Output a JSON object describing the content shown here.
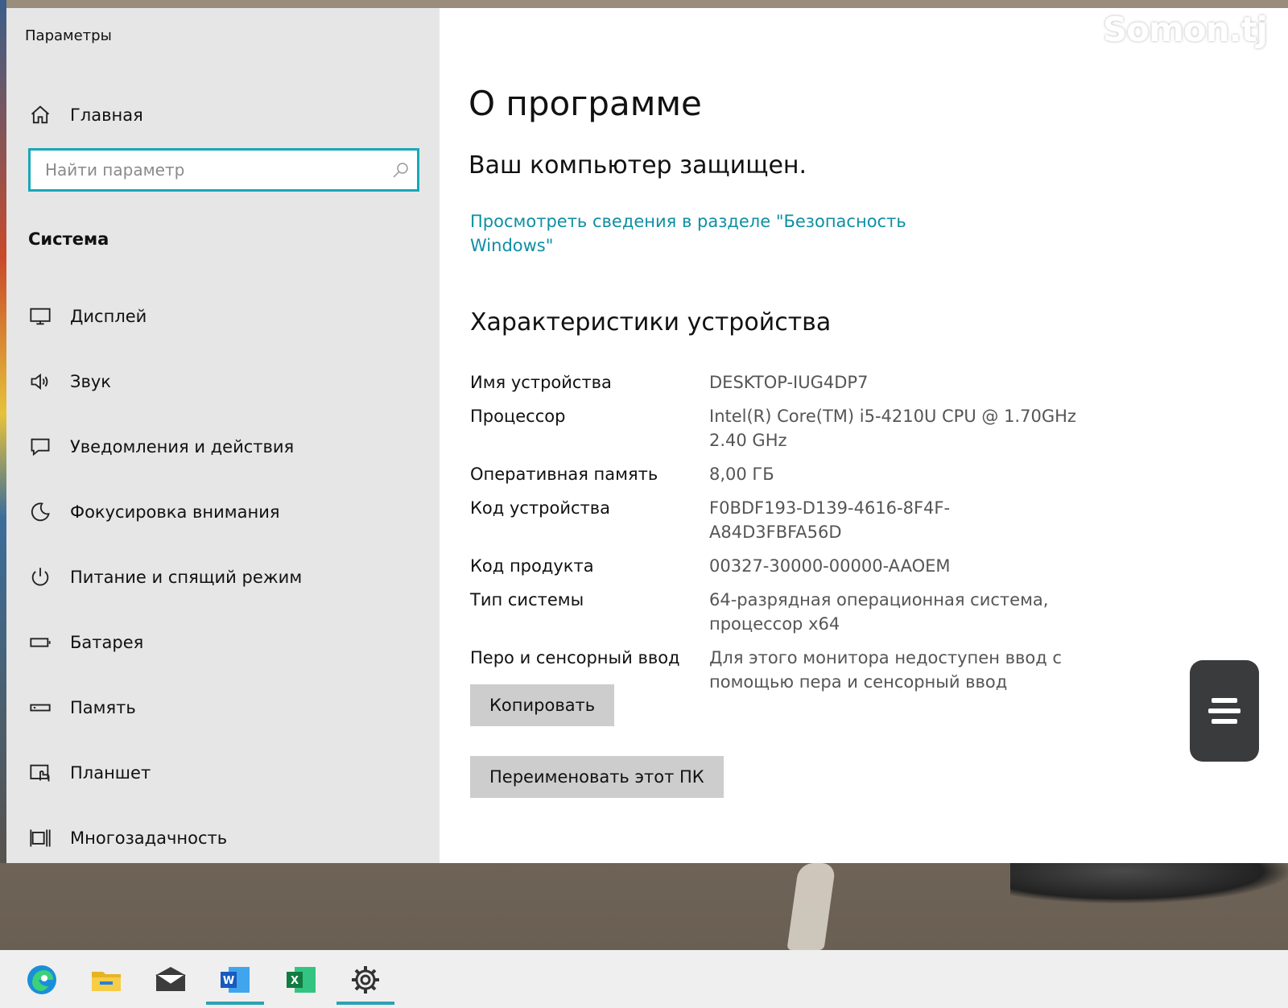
{
  "window": {
    "title": "Параметры"
  },
  "sidebar": {
    "home_label": "Главная",
    "search_placeholder": "Найти параметр",
    "section": "Система",
    "items": [
      {
        "label": "Дисплей",
        "icon": "display-icon"
      },
      {
        "label": "Звук",
        "icon": "speaker-icon"
      },
      {
        "label": "Уведомления и действия",
        "icon": "notification-icon"
      },
      {
        "label": "Фокусировка внимания",
        "icon": "moon-icon"
      },
      {
        "label": "Питание и спящий режим",
        "icon": "power-icon"
      },
      {
        "label": "Батарея",
        "icon": "battery-icon"
      },
      {
        "label": "Память",
        "icon": "storage-icon"
      },
      {
        "label": "Планшет",
        "icon": "tablet-icon"
      },
      {
        "label": "Многозадачность",
        "icon": "multitasking-icon"
      }
    ]
  },
  "main": {
    "title": "О программе",
    "protected": "Ваш компьютер защищен.",
    "security_link": "Просмотреть сведения в разделе \"Безопасность Windows\"",
    "specs_title": "Характеристики устройства",
    "specs": [
      {
        "key": "Имя устройства",
        "value": "DESKTOP-IUG4DP7"
      },
      {
        "key": "Процессор",
        "value": "Intel(R) Core(TM) i5-4210U CPU @ 1.70GHz 2.40 GHz"
      },
      {
        "key": "Оперативная память",
        "value": "8,00 ГБ"
      },
      {
        "key": "Код устройства",
        "value": "F0BDF193-D139-4616-8F4F-A84D3FBFA56D"
      },
      {
        "key": "Код продукта",
        "value": "00327-30000-00000-AAOEM"
      },
      {
        "key": "Тип системы",
        "value": "64-разрядная операционная система, процессор x64"
      },
      {
        "key": "Перо и сенсорный ввод",
        "value": "Для этого монитора недоступен ввод с помощью пера и сенсорный ввод"
      }
    ],
    "copy_button": "Копировать",
    "rename_button": "Переименовать этот ПК"
  },
  "watermark": "Somon.tj",
  "taskbar": {
    "items": [
      "edge-icon",
      "file-explorer-icon",
      "mail-icon",
      "word-icon",
      "excel-icon",
      "settings-icon"
    ],
    "active": [
      "word-icon",
      "settings-icon"
    ]
  },
  "colors": {
    "accent": "#17a8b8",
    "link": "#0e8fa3",
    "sidebar_bg": "#e6e6e6",
    "button_bg": "#cdcdcd"
  }
}
